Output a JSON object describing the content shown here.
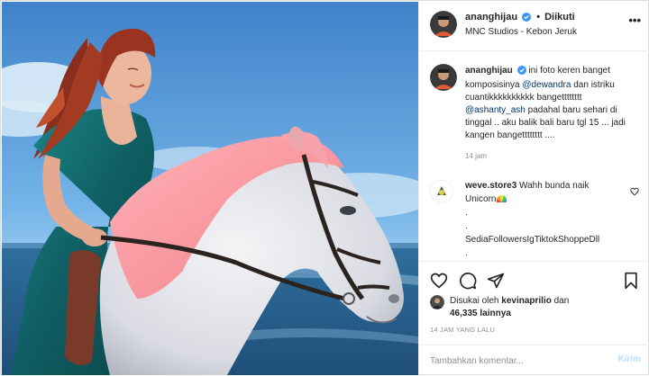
{
  "post": {
    "username": "ananghijau",
    "follow_status": "Diikuti",
    "location": "MNC Studios - Kebon Jeruk",
    "more_label": "•••"
  },
  "caption": {
    "username": "ananghijau",
    "text_1": "ini foto keren banget komposisinya",
    "mention_1": "@dewandra",
    "text_2": "dan istriku cuantikkkkkkkkkk bangetttttttt",
    "mention_2": "@ashanty_ash",
    "text_3": "padahal baru sehari di tinggal .. aku balik bali baru tgl 15 ... jadi kangen bangetttttttt ....",
    "time": "14 jam"
  },
  "comment": {
    "username": "weve.store3",
    "text": "Wahh bunda naik Unicorn",
    "line_1": ".",
    "line_2": ".",
    "line_3": "SediaFollowersIgTiktokShoppeDll",
    "line_4": "."
  },
  "likes": {
    "prefix": "Disukai oleh",
    "user": "kevinaprilio",
    "middle": "dan",
    "count": "46,335 lainnya"
  },
  "date_label": "14 JAM YANG LALU",
  "add_comment": {
    "placeholder": "Tambahkan komentar...",
    "post_label": "Kirim"
  },
  "icons": {
    "like": "heart-icon",
    "comment": "comment-icon",
    "share": "paper-plane-icon",
    "save": "bookmark-icon",
    "verified": "verified-badge-icon"
  },
  "colors": {
    "accent": "#0095f6",
    "verified": "#3897f0",
    "mention": "#00376b",
    "muted": "#8e8e8e",
    "post_disabled": "#b2dffc"
  }
}
